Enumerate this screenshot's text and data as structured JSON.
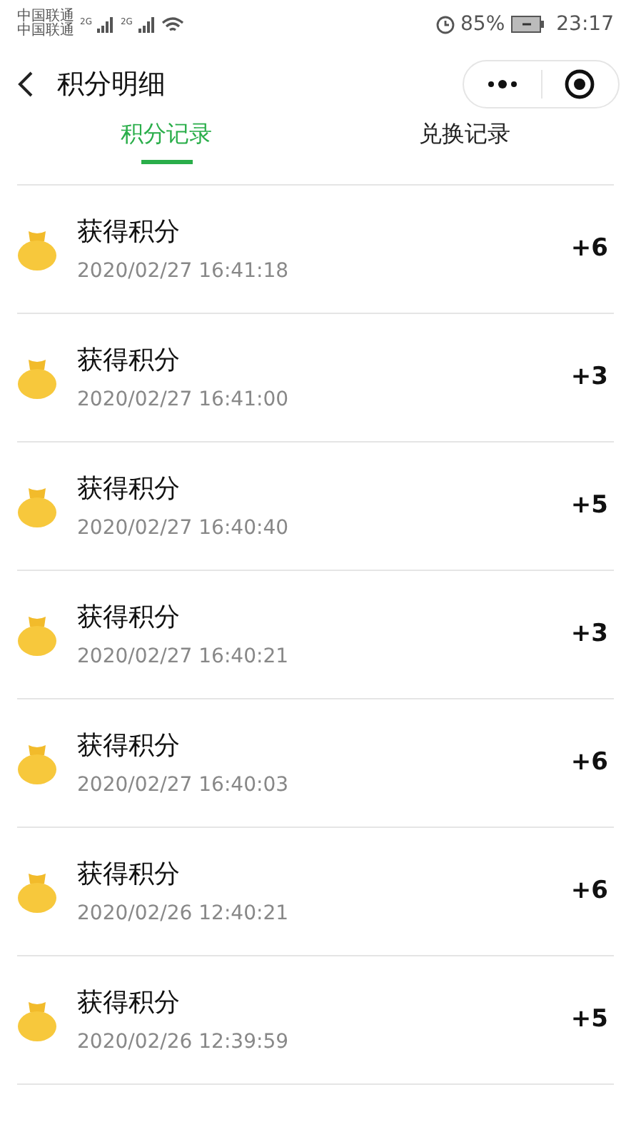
{
  "status_bar": {
    "carrier_1": "中国联通",
    "carrier_2": "中国联通",
    "network_1": "2G",
    "network_2": "2G",
    "battery": "85%",
    "time": "23:17"
  },
  "header": {
    "title": "积分明细"
  },
  "tabs": [
    {
      "label": "积分记录",
      "selected": true
    },
    {
      "label": "兑换记录",
      "selected": false
    }
  ],
  "records": [
    {
      "title": "获得积分",
      "time": "2020/02/27 16:41:18",
      "points": "+6"
    },
    {
      "title": "获得积分",
      "time": "2020/02/27 16:41:00",
      "points": "+3"
    },
    {
      "title": "获得积分",
      "time": "2020/02/27 16:40:40",
      "points": "+5"
    },
    {
      "title": "获得积分",
      "time": "2020/02/27 16:40:21",
      "points": "+3"
    },
    {
      "title": "获得积分",
      "time": "2020/02/27 16:40:03",
      "points": "+6"
    },
    {
      "title": "获得积分",
      "time": "2020/02/26 12:40:21",
      "points": "+6"
    },
    {
      "title": "获得积分",
      "time": "2020/02/26 12:39:59",
      "points": "+5"
    }
  ]
}
